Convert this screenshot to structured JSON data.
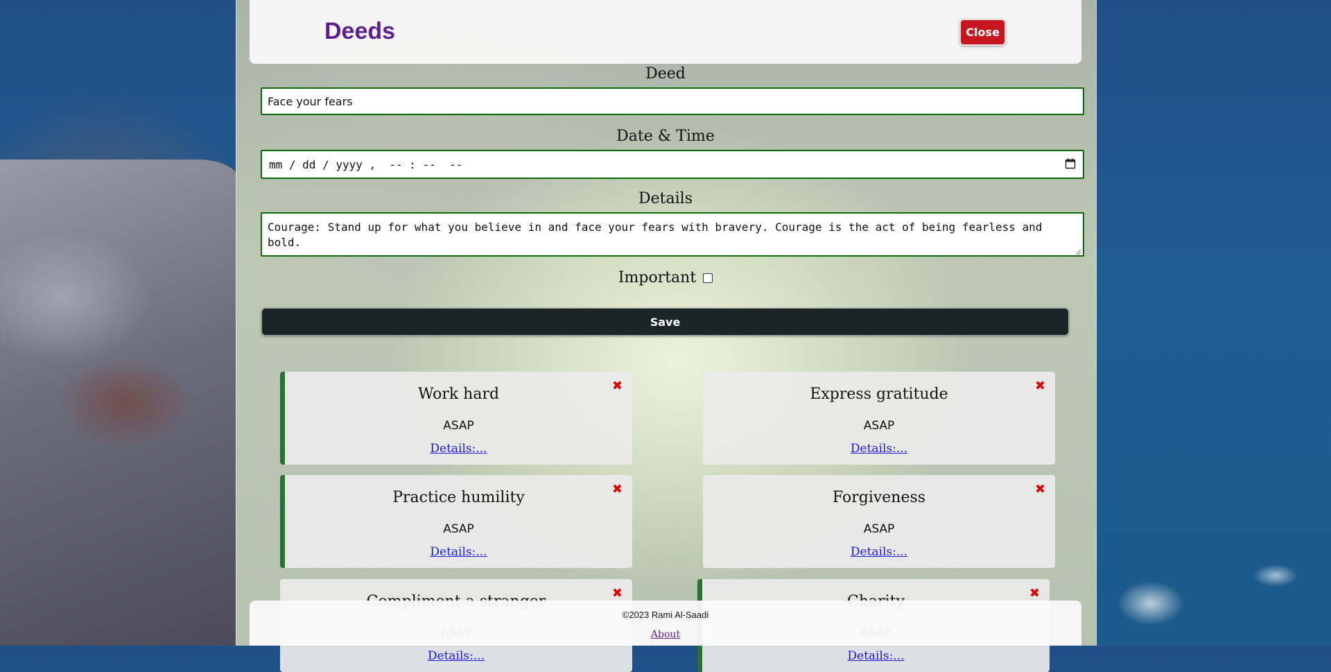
{
  "header": {
    "title": "Deeds",
    "close_label": "Close"
  },
  "form": {
    "deed_label": "Deed",
    "deed_value": "Face your fears",
    "datetime_label": "Date & Time",
    "datetime_placeholder": "mm / dd / yyyy ,  -- : --  --",
    "details_label": "Details",
    "details_value": "Courage: Stand up for what you believe in and face your fears with bravery. Courage is the act of being fearless and bold.",
    "important_label": "Important",
    "important_checked": false,
    "save_label": "Save"
  },
  "deeds": [
    {
      "title": "Work hard",
      "date": "ASAP",
      "details": "Details:...",
      "important": true
    },
    {
      "title": "Express gratitude",
      "date": "ASAP",
      "details": "Details:...",
      "important": false
    },
    {
      "title": "Practice humility",
      "date": "ASAP",
      "details": "Details:...",
      "important": true
    },
    {
      "title": "Forgiveness",
      "date": "ASAP",
      "details": "Details:...",
      "important": false
    },
    {
      "title": "Compliment a stranger",
      "date": "ASAP",
      "details": "Details:...",
      "important": false
    },
    {
      "title": "Charity",
      "date": "ASAP",
      "details": "Details:...",
      "important": true
    }
  ],
  "remove_glyph": "✖",
  "footer": {
    "copyright": "©2023 Rami Al-Saadi",
    "about_label": "About"
  },
  "colors": {
    "brand": "#5b1f8f",
    "danger": "#c6161f",
    "save": "#1b2428",
    "important_bar": "#2e6f35",
    "field_border": "#0a6a0a"
  }
}
